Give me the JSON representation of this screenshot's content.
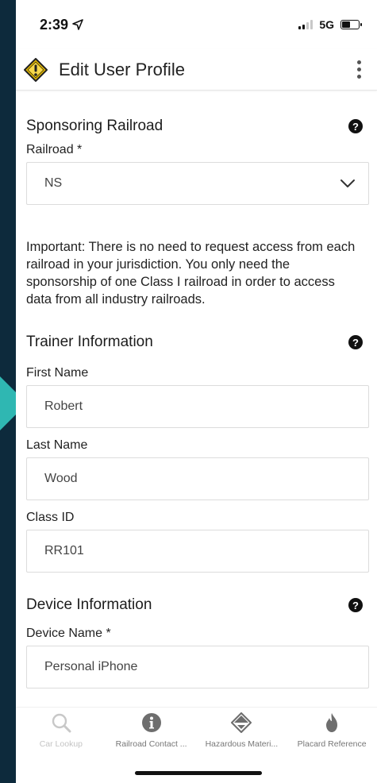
{
  "status_bar": {
    "time": "2:39",
    "network": "5G",
    "battery_level": 0.5
  },
  "app_bar": {
    "title": "Edit User Profile"
  },
  "sponsoring": {
    "heading": "Sponsoring Railroad",
    "railroad_label": "Railroad *",
    "railroad_value": "NS",
    "notice": "Important: There is no need to request access from each railroad in your jurisdiction. You only need the sponsorship of one Class I railroad in order to access data from all industry railroads."
  },
  "trainer": {
    "heading": "Trainer Information",
    "first_name_label": "First Name",
    "first_name_value": "Robert",
    "last_name_label": "Last Name",
    "last_name_value": "Wood",
    "class_id_label": "Class ID",
    "class_id_value": "RR101"
  },
  "device": {
    "heading": "Device Information",
    "device_name_label": "Device Name *",
    "device_name_value": "Personal iPhone"
  },
  "help_glyph": "?",
  "bottom_nav": [
    {
      "label": "Car Lookup",
      "icon": "search-icon"
    },
    {
      "label": "Railroad Contact ...",
      "icon": "info-icon"
    },
    {
      "label": "Hazardous Materi...",
      "icon": "hazmat-placard-icon"
    },
    {
      "label": "Placard Reference",
      "icon": "flame-icon"
    }
  ],
  "colors": {
    "logo_yellow": "#f2c300",
    "accent_teal": "#2fb7b2",
    "background_navy": "#0d2a3c"
  }
}
